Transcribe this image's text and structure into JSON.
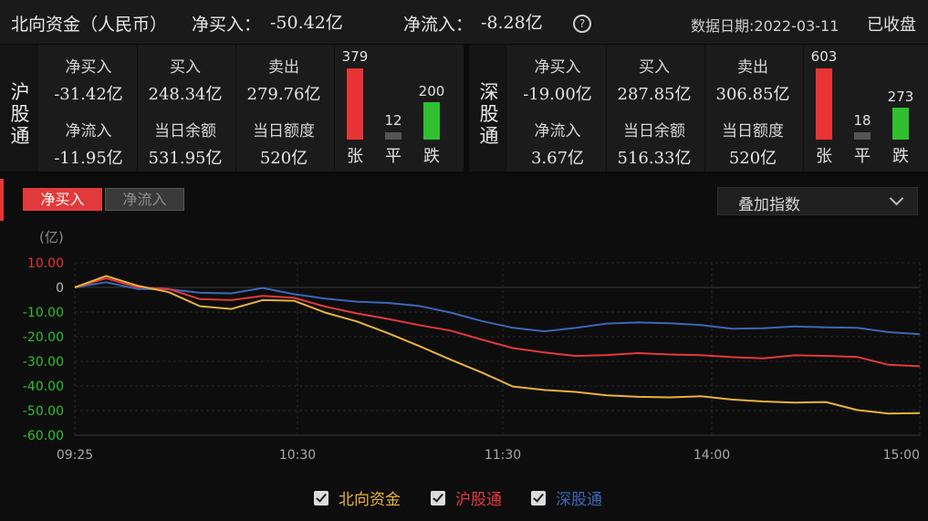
{
  "header": {
    "title": "北向资金（人民币）",
    "net_buy_label": "净买入：",
    "net_buy_value": "-50.42亿",
    "net_inflow_label": "净流入：",
    "net_inflow_value": "-8.28亿",
    "help_icon": "?",
    "date_label": "数据日期:2022-03-11",
    "status": "已收盘"
  },
  "sh": {
    "name": [
      "沪",
      "股",
      "通"
    ],
    "net_buy_label": "净买入",
    "net_buy": "-31.42亿",
    "buy_label": "买入",
    "buy": "248.34亿",
    "sell_label": "卖出",
    "sell": "279.76亿",
    "net_inflow_label": "净流入",
    "net_inflow": "-11.95亿",
    "balance_label": "当日余额",
    "balance": "531.95亿",
    "quota_label": "当日额度",
    "quota": "520亿",
    "up": 379,
    "flat": 12,
    "down": 200,
    "up_label": "张",
    "flat_label": "平",
    "down_label": "跌"
  },
  "sz": {
    "name": [
      "深",
      "股",
      "通"
    ],
    "net_buy_label": "净买入",
    "net_buy": "-19.00亿",
    "buy_label": "买入",
    "buy": "287.85亿",
    "sell_label": "卖出",
    "sell": "306.85亿",
    "net_inflow_label": "净流入",
    "net_inflow": "3.67亿",
    "balance_label": "当日余额",
    "balance": "516.33亿",
    "quota_label": "当日额度",
    "quota": "520亿",
    "up": 603,
    "flat": 18,
    "down": 273,
    "up_label": "张",
    "flat_label": "平",
    "down_label": "跌"
  },
  "tabs": {
    "active": "净买入",
    "inactive": "净流入"
  },
  "dropdown": {
    "label": "叠加指数"
  },
  "colors": {
    "north": "#e8b33a",
    "sh": "#e33a3a",
    "sz": "#3a68b8",
    "up": "#e83434",
    "down": "#2fbf2f",
    "flat": "#555555"
  },
  "chart_data": {
    "type": "line",
    "unit": "(亿)",
    "ylim": [
      -60,
      10
    ],
    "yticks": [
      "10.00",
      "0",
      "-10.00",
      "-20.00",
      "-30.00",
      "-40.00",
      "-50.00",
      "-60.00"
    ],
    "xticks": [
      "09:25",
      "10:30",
      "11:30",
      "14:00",
      "15:00"
    ],
    "grid": true,
    "x": [
      "09:30",
      "09:35",
      "09:40",
      "09:45",
      "09:50",
      "10:00",
      "10:10",
      "10:20",
      "10:30",
      "10:40",
      "10:50",
      "11:00",
      "11:10",
      "11:20",
      "11:30",
      "13:00",
      "13:10",
      "13:20",
      "13:30",
      "13:40",
      "13:50",
      "14:00",
      "14:10",
      "14:20",
      "14:30",
      "14:40",
      "14:50",
      "15:00"
    ],
    "series": [
      {
        "name": "北向资金",
        "values": [
          0,
          4,
          0,
          -2,
          -7,
          -8,
          -5,
          -6,
          -11,
          -14,
          -18,
          -23,
          -29,
          -35,
          -41,
          -42,
          -42,
          -43,
          -44,
          -45,
          -45,
          -46,
          -46,
          -46,
          -46,
          -50,
          -52,
          -51
        ]
      },
      {
        "name": "沪股通",
        "values": [
          0,
          3,
          0,
          0,
          -4,
          -5,
          -4,
          -5,
          -8,
          -10,
          -12,
          -15,
          -18,
          -22,
          -25,
          -26,
          -27,
          -27,
          -27,
          -28,
          -28,
          -28,
          -28,
          -27,
          -28,
          -29,
          -32,
          -32
        ]
      },
      {
        "name": "深股通",
        "values": [
          0,
          2,
          0,
          0,
          -2,
          -3,
          -1,
          -3,
          -4,
          -5,
          -6,
          -8,
          -11,
          -14,
          -16,
          -17,
          -16,
          -15,
          -15,
          -15,
          -15,
          -16,
          -16,
          -16,
          -17,
          -17,
          -18,
          -19
        ]
      }
    ]
  }
}
